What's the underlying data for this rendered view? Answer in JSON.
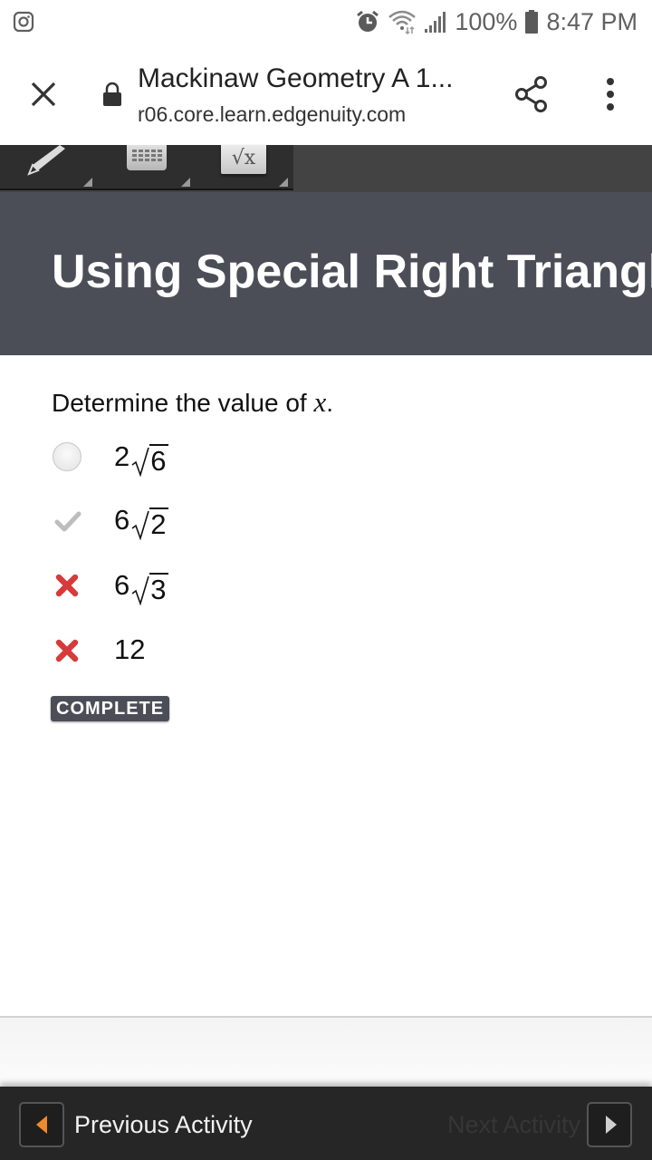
{
  "status_bar": {
    "left_icon": "instagram-icon",
    "icons": [
      "alarm-icon",
      "wifi-icon",
      "signal-icon"
    ],
    "battery": "100%",
    "time": "8:47 PM"
  },
  "tab": {
    "title": "Mackinaw Geometry A 1...",
    "url": "r06.core.learn.edgenuity.com",
    "close_icon": "close-icon",
    "lock_icon": "lock-icon",
    "share_icon": "share-icon",
    "menu_icon": "more-vert-icon"
  },
  "toolbar": {
    "tools": [
      {
        "name": "pencil",
        "icon": "pencil-icon"
      },
      {
        "name": "keypad",
        "icon": "keypad-icon"
      },
      {
        "name": "sqrt",
        "icon": "sqrt-icon",
        "label": "√x"
      }
    ]
  },
  "banner": {
    "title": "Using Special Right Triangles"
  },
  "question": {
    "prompt_prefix": "Determine the value of ",
    "prompt_var": "x",
    "prompt_suffix": ".",
    "options": [
      {
        "coef": "2",
        "radicand": "6",
        "plain": null,
        "state": "unselected",
        "state_icon": "radio-icon"
      },
      {
        "coef": "6",
        "radicand": "2",
        "plain": null,
        "state": "correct",
        "state_icon": "check-icon"
      },
      {
        "coef": "6",
        "radicand": "3",
        "plain": null,
        "state": "incorrect",
        "state_icon": "x-icon"
      },
      {
        "coef": null,
        "radicand": null,
        "plain": "12",
        "state": "incorrect",
        "state_icon": "x-icon"
      }
    ],
    "status_badge": "COMPLETE"
  },
  "navigation": {
    "previous_label": "Previous Activity",
    "next_label": "Next Activity",
    "previous_enabled": true,
    "next_enabled": false
  },
  "colors": {
    "banner_bg": "#4c4e57",
    "incorrect_red": "#d63a3a",
    "correct_gray": "#bdbdbd",
    "prev_arrow_orange": "#f0892a",
    "navbar_bg": "#262626"
  }
}
